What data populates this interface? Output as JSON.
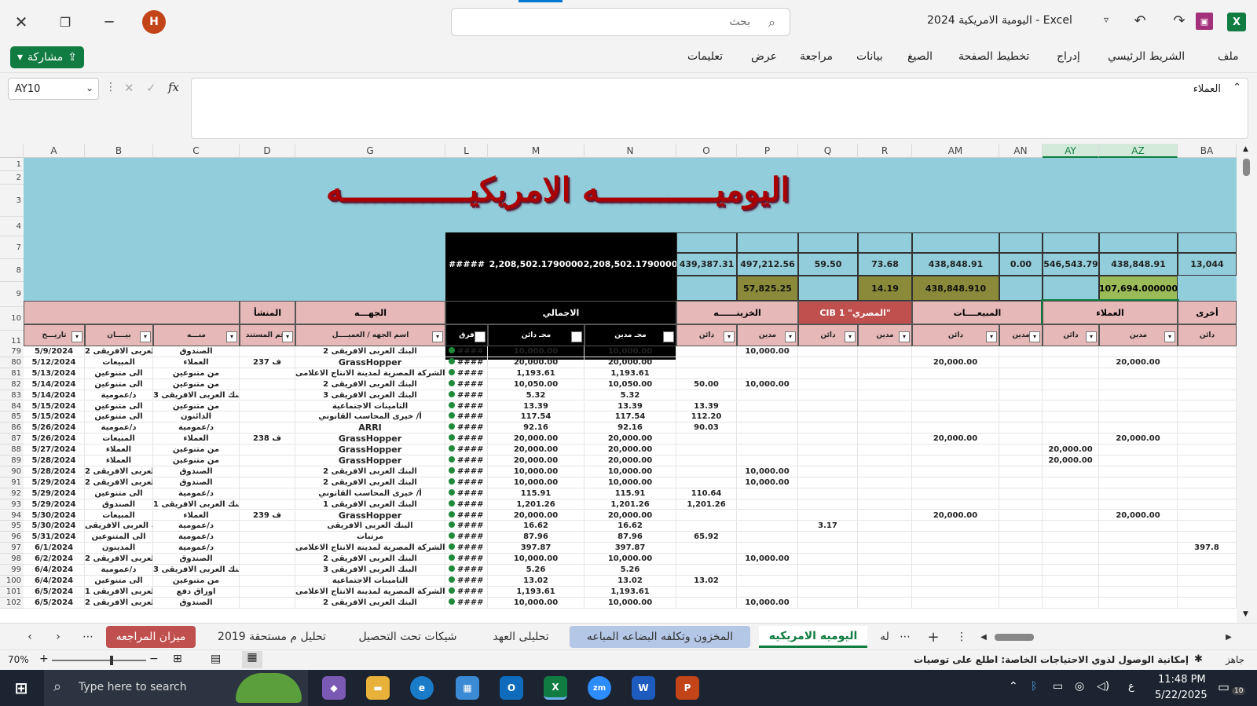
{
  "window": {
    "title": "اليومية الامريكية 2024 - Excel",
    "search_placeholder": "بحث",
    "user_initial": "H",
    "share_label": "مشاركة"
  },
  "ribbon": {
    "tabs": [
      "ملف",
      "الشريط الرئيسي",
      "إدراج",
      "تخطيط الصفحة",
      "الصيغ",
      "بيانات",
      "مراجعة",
      "عرض",
      "تعليمات"
    ]
  },
  "formula_bar": {
    "name_box": "AY10",
    "fx": "fx",
    "content": "العملاء"
  },
  "sheet": {
    "columns": [
      "A",
      "B",
      "C",
      "D",
      "G",
      "L",
      "M",
      "N",
      "O",
      "P",
      "Q",
      "R",
      "AM",
      "AN",
      "AY",
      "AZ",
      "BA"
    ],
    "selected_columns": [
      "AY",
      "AZ"
    ],
    "top_row_numbers": [
      "1",
      "2",
      "3",
      "4",
      "7",
      "8",
      "9",
      "10",
      "11"
    ],
    "title": "اليوميــــــــــــه الامريكيـــــــــــــه",
    "totals_row8": [
      "#####",
      "2,208,502.1790000",
      "2,208,502.1790000",
      "439,387.31",
      "497,212.56",
      "59.50",
      "73.68",
      "438,848.91",
      "0.00",
      "546,543.79",
      "438,848.91",
      "13,044"
    ],
    "totals_row9": {
      "P": "57,825.25",
      "R": "14.19",
      "AM": "438,848.910",
      "AZ": "107,694.000000"
    },
    "group_headers": {
      "D": "المنشأ",
      "G": "الجهـــه",
      "MN": "الاجمالي",
      "OP": "الخزينــــــه",
      "QR": "CIB 1 \"المصري\"",
      "AMAN": "المبيعــــات",
      "AYAZ": "العملاء",
      "BA": "أخرى"
    },
    "filter_headers": [
      "تاريـــخ",
      "بيــــان",
      "منـــه",
      "رقم المستند",
      "اسم الجهه / العميــــل",
      "فرق",
      "مجـ دائن",
      "مجـ مدين",
      "دائن",
      "مدين",
      "دائن",
      "مدين",
      "دائن",
      "مدين",
      "دائن",
      "مدين",
      "دائن"
    ],
    "rows": [
      {
        "n": "79",
        "A": "5/9/2024",
        "B": "البنك العربى الافريقى 2",
        "C": "الصندوق",
        "D": "",
        "G": "البنك العربى الافريقى 2",
        "M": "10,000.00",
        "N": "10,000.00",
        "O": "",
        "P": "10,000.00",
        "Q": "",
        "AM": "",
        "AY": "",
        "AZ": "",
        "BA": ""
      },
      {
        "n": "80",
        "A": "5/12/2024",
        "B": "المبيعات",
        "C": "العملاء",
        "D": "ف 237",
        "G": "GrassHopper",
        "M": "20,000.00",
        "N": "20,000.00",
        "O": "",
        "P": "",
        "Q": "",
        "AM": "20,000.00",
        "AY": "",
        "AZ": "20,000.00",
        "BA": ""
      },
      {
        "n": "81",
        "A": "5/13/2024",
        "B": "الى متنوعين",
        "C": "من متنوعين",
        "D": "",
        "G": "الشركة المصرية لمدينة الانتاج الاعلامى",
        "M": "1,193.61",
        "N": "1,193.61",
        "O": "",
        "P": "",
        "Q": "",
        "AM": "",
        "AY": "",
        "AZ": "",
        "BA": ""
      },
      {
        "n": "82",
        "A": "5/14/2024",
        "B": "الى متنوعين",
        "C": "من متنوعين",
        "D": "",
        "G": "البنك العربى الافريقى 2",
        "M": "10,050.00",
        "N": "10,050.00",
        "O": "50.00",
        "P": "10,000.00",
        "Q": "",
        "AM": "",
        "AY": "",
        "AZ": "",
        "BA": ""
      },
      {
        "n": "83",
        "A": "5/14/2024",
        "B": "د/عمومية",
        "C": "البنك العربى الافريقى 3",
        "D": "",
        "G": "البنك العربى الافريقى 3",
        "M": "5.32",
        "N": "5.32",
        "O": "",
        "P": "",
        "Q": "",
        "AM": "",
        "AY": "",
        "AZ": "",
        "BA": ""
      },
      {
        "n": "84",
        "A": "5/15/2024",
        "B": "الى متنوعين",
        "C": "من متنوعين",
        "D": "",
        "G": "التامينات الاجتماعية",
        "M": "13.39",
        "N": "13.39",
        "O": "13.39",
        "P": "",
        "Q": "",
        "AM": "",
        "AY": "",
        "AZ": "",
        "BA": ""
      },
      {
        "n": "85",
        "A": "5/15/2024",
        "B": "الى متنوعين",
        "C": "الدائنون",
        "D": "",
        "G": "أ/ خيرى المحاسب القانوني",
        "M": "117.54",
        "N": "117.54",
        "O": "112.20",
        "P": "",
        "Q": "",
        "AM": "",
        "AY": "",
        "AZ": "",
        "BA": ""
      },
      {
        "n": "86",
        "A": "5/26/2024",
        "B": "د/عمومية",
        "C": "د/عمومية",
        "D": "",
        "G": "ARRI",
        "M": "92.16",
        "N": "92.16",
        "O": "90.03",
        "P": "",
        "Q": "",
        "AM": "",
        "AY": "",
        "AZ": "",
        "BA": ""
      },
      {
        "n": "87",
        "A": "5/26/2024",
        "B": "المبيعات",
        "C": "العملاء",
        "D": "ف 238",
        "G": "GrassHopper",
        "M": "20,000.00",
        "N": "20,000.00",
        "O": "",
        "P": "",
        "Q": "",
        "AM": "20,000.00",
        "AY": "",
        "AZ": "20,000.00",
        "BA": ""
      },
      {
        "n": "88",
        "A": "5/27/2024",
        "B": "العملاء",
        "C": "من متنوعين",
        "D": "",
        "G": "GrassHopper",
        "M": "20,000.00",
        "N": "20,000.00",
        "O": "",
        "P": "",
        "Q": "",
        "AM": "",
        "AY": "20,000.00",
        "AZ": "",
        "BA": ""
      },
      {
        "n": "89",
        "A": "5/28/2024",
        "B": "العملاء",
        "C": "من متنوعين",
        "D": "",
        "G": "GrassHopper",
        "M": "20,000.00",
        "N": "20,000.00",
        "O": "",
        "P": "",
        "Q": "",
        "AM": "",
        "AY": "20,000.00",
        "AZ": "",
        "BA": ""
      },
      {
        "n": "90",
        "A": "5/28/2024",
        "B": "البنك العربى الافريقى 2",
        "C": "الصندوق",
        "D": "",
        "G": "البنك العربى الافريقى 2",
        "M": "10,000.00",
        "N": "10,000.00",
        "O": "",
        "P": "10,000.00",
        "Q": "",
        "AM": "",
        "AY": "",
        "AZ": "",
        "BA": ""
      },
      {
        "n": "91",
        "A": "5/29/2024",
        "B": "البنك العربى الافريقى 2",
        "C": "الصندوق",
        "D": "",
        "G": "البنك العربى الافريقى 2",
        "M": "10,000.00",
        "N": "10,000.00",
        "O": "",
        "P": "10,000.00",
        "Q": "",
        "AM": "",
        "AY": "",
        "AZ": "",
        "BA": ""
      },
      {
        "n": "92",
        "A": "5/29/2024",
        "B": "الى متنوعين",
        "C": "د/عمومية",
        "D": "",
        "G": "أ/ خيرى المحاسب القانوني",
        "M": "115.91",
        "N": "115.91",
        "O": "110.64",
        "P": "",
        "Q": "",
        "AM": "",
        "AY": "",
        "AZ": "",
        "BA": ""
      },
      {
        "n": "93",
        "A": "5/29/2024",
        "B": "الصندوق",
        "C": "البنك العربى الافريقى 1",
        "D": "",
        "G": "البنك العربى الافريقى 1",
        "M": "1,201.26",
        "N": "1,201.26",
        "O": "1,201.26",
        "P": "",
        "Q": "",
        "AM": "",
        "AY": "",
        "AZ": "",
        "BA": ""
      },
      {
        "n": "94",
        "A": "5/30/2024",
        "B": "المبيعات",
        "C": "العملاء",
        "D": "ف 239",
        "G": "GrassHopper",
        "M": "20,000.00",
        "N": "20,000.00",
        "O": "",
        "P": "",
        "Q": "",
        "AM": "20,000.00",
        "AY": "",
        "AZ": "20,000.00",
        "BA": ""
      },
      {
        "n": "95",
        "A": "5/30/2024",
        "B": "البنك العربى الافريقى",
        "C": "د/عمومية",
        "D": "",
        "G": "البنك العربى الافريقى",
        "M": "16.62",
        "N": "16.62",
        "O": "",
        "P": "",
        "Q": "3.17",
        "AM": "",
        "AY": "",
        "AZ": "",
        "BA": ""
      },
      {
        "n": "96",
        "A": "5/31/2024",
        "B": "الى المتنوعين",
        "C": "د/عمومية",
        "D": "",
        "G": "مرتبات",
        "M": "87.96",
        "N": "87.96",
        "O": "65.92",
        "P": "",
        "Q": "",
        "AM": "",
        "AY": "",
        "AZ": "",
        "BA": ""
      },
      {
        "n": "97",
        "A": "6/1/2024",
        "B": "المدينون",
        "C": "د/عمومية",
        "D": "",
        "G": "الشركة المصرية لمدينة الانتاج الاعلامى",
        "M": "397.87",
        "N": "397.87",
        "O": "",
        "P": "",
        "Q": "",
        "AM": "",
        "AY": "",
        "AZ": "",
        "BA": "397.8"
      },
      {
        "n": "98",
        "A": "6/2/2024",
        "B": "البنك العربى الافريقى 2",
        "C": "الصندوق",
        "D": "",
        "G": "البنك العربى الافريقى 2",
        "M": "10,000.00",
        "N": "10,000.00",
        "O": "",
        "P": "10,000.00",
        "Q": "",
        "AM": "",
        "AY": "",
        "AZ": "",
        "BA": ""
      },
      {
        "n": "99",
        "A": "6/4/2024",
        "B": "د/عمومية",
        "C": "البنك العربى الافريقى 3",
        "D": "",
        "G": "البنك العربى الافريقى 3",
        "M": "5.26",
        "N": "5.26",
        "O": "",
        "P": "",
        "Q": "",
        "AM": "",
        "AY": "",
        "AZ": "",
        "BA": ""
      },
      {
        "n": "100",
        "A": "6/4/2024",
        "B": "الى متنوعين",
        "C": "من متنوعين",
        "D": "",
        "G": "التامينات الاجتماعية",
        "M": "13.02",
        "N": "13.02",
        "O": "13.02",
        "P": "",
        "Q": "",
        "AM": "",
        "AY": "",
        "AZ": "",
        "BA": ""
      },
      {
        "n": "101",
        "A": "6/5/2024",
        "B": "البنك العربى الافريقى 1",
        "C": "اوراق دفع",
        "D": "",
        "G": "الشركة المصرية لمدينة الانتاج الاعلامى",
        "M": "1,193.61",
        "N": "1,193.61",
        "O": "",
        "P": "",
        "Q": "",
        "AM": "",
        "AY": "",
        "AZ": "",
        "BA": ""
      },
      {
        "n": "102",
        "A": "6/5/2024",
        "B": "البنك العربى الافريقى 2",
        "C": "الصندوق",
        "D": "",
        "G": "البنك العربى الافريقى 2",
        "M": "10,000.00",
        "N": "10,000.00",
        "O": "",
        "P": "10,000.00",
        "Q": "",
        "AM": "",
        "AY": "",
        "AZ": "",
        "BA": ""
      }
    ],
    "diff_value": "####"
  },
  "sheet_tabs": [
    "اليوميه الامريكيه",
    "المخزون وتكلفه البضاعه المباعه",
    "تحليلى العهد",
    "شيكات تحت التحصيل",
    "تحليل م مستحقة 2019",
    "ميزان المراجعه",
    "له"
  ],
  "status_bar": {
    "ready": "جاهز",
    "accessibility": "إمكانية الوصول لذوي الاحتياجات الخاصة: اطلع على توصيات",
    "zoom": "70%"
  },
  "taskbar": {
    "search_placeholder": "Type here to search",
    "time": "11:48 PM",
    "date": "5/22/2025",
    "notifications": "10",
    "lang": "ع"
  },
  "colors": {
    "banner": "#92cddc",
    "group_header": "#e6b8b7",
    "cib_header": "#c0504d",
    "green_total": "#9bbb59",
    "title": "#a00000"
  }
}
